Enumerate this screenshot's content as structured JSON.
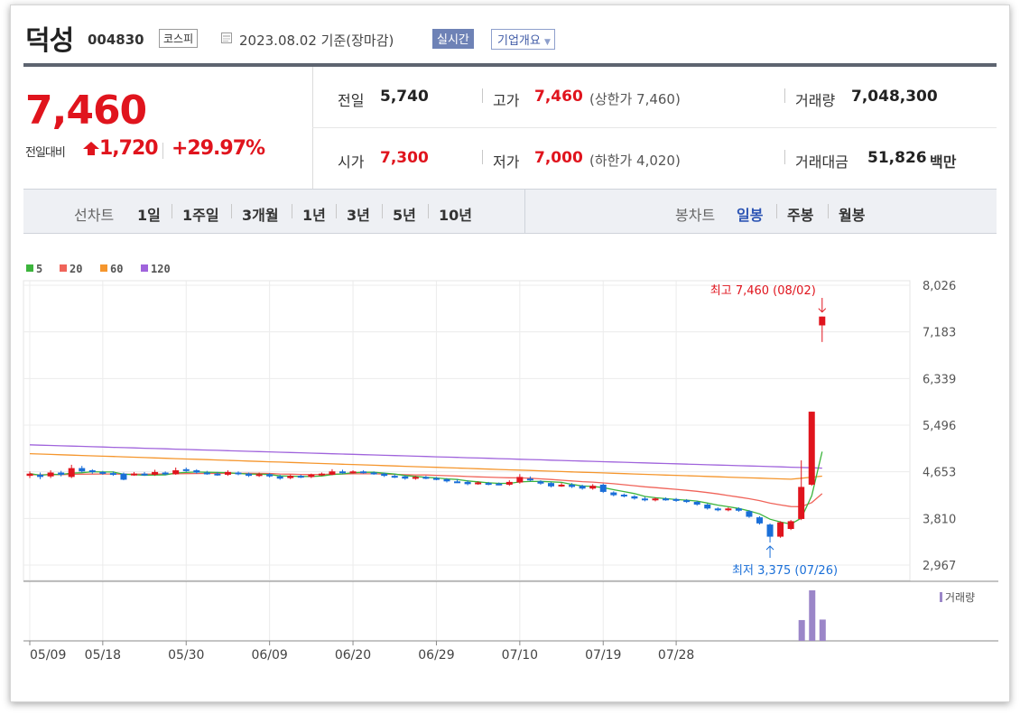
{
  "header": {
    "name": "덕성",
    "code": "004830",
    "market": "코스피",
    "date": "2023.08.02 기준(장마감)",
    "realtime": "실시간",
    "overview": "기업개요"
  },
  "quote": {
    "price": "7,460",
    "change_label": "전일대비",
    "change_amount": "1,720",
    "change_percent": "+29.97%"
  },
  "stats": {
    "prev_close_label": "전일",
    "prev_close": "5,740",
    "high_label": "고가",
    "high": "7,460",
    "upper_limit": "(상한가 7,460)",
    "volume_label": "거래량",
    "volume": "7,048,300",
    "open_label": "시가",
    "open": "7,300",
    "low_label": "저가",
    "low": "7,000",
    "lower_limit": "(하한가 4,020)",
    "amount_label": "거래대금",
    "amount": "51,826",
    "amount_unit": "백만"
  },
  "tabs": {
    "line_label": "선차트",
    "line_periods": [
      "1일",
      "1주일",
      "3개월",
      "1년",
      "3년",
      "5년",
      "10년"
    ],
    "candle_label": "봉차트",
    "candle_periods": [
      "일봉",
      "주봉",
      "월봉"
    ],
    "candle_active": "일봉"
  },
  "chart_data": {
    "type": "candlestick",
    "legend": [
      {
        "name": "5",
        "color": "#3cb43c"
      },
      {
        "name": "20",
        "color": "#f0645a"
      },
      {
        "name": "60",
        "color": "#f5962d"
      },
      {
        "name": "120",
        "color": "#a064dc"
      }
    ],
    "y_ticks": [
      "8,026",
      "7,183",
      "6,339",
      "5,496",
      "4,653",
      "3,810",
      "2,967"
    ],
    "ylim": [
      2967,
      8026
    ],
    "x_ticks": [
      "05/09",
      "05/18",
      "05/30",
      "06/09",
      "06/20",
      "06/29",
      "07/10",
      "07/19",
      "07/28"
    ],
    "high_annotation": "최고 7,460 (08/02)",
    "low_annotation": "최저 3,375 (07/26)",
    "volume_label": "거래량",
    "up_color": "#e0141d",
    "down_color": "#1a6fd8",
    "candles": [
      {
        "o": 4580,
        "c": 4620,
        "h": 4660,
        "l": 4540
      },
      {
        "o": 4600,
        "c": 4560,
        "h": 4640,
        "l": 4520
      },
      {
        "o": 4570,
        "c": 4640,
        "h": 4680,
        "l": 4540
      },
      {
        "o": 4640,
        "c": 4600,
        "h": 4670,
        "l": 4570
      },
      {
        "o": 4560,
        "c": 4720,
        "h": 4780,
        "l": 4540
      },
      {
        "o": 4720,
        "c": 4660,
        "h": 4760,
        "l": 4640
      },
      {
        "o": 4680,
        "c": 4650,
        "h": 4700,
        "l": 4620
      },
      {
        "o": 4650,
        "c": 4620,
        "h": 4670,
        "l": 4600
      },
      {
        "o": 4630,
        "c": 4600,
        "h": 4660,
        "l": 4580
      },
      {
        "o": 4620,
        "c": 4510,
        "h": 4640,
        "l": 4500
      },
      {
        "o": 4600,
        "c": 4620,
        "h": 4650,
        "l": 4580
      },
      {
        "o": 4620,
        "c": 4600,
        "h": 4650,
        "l": 4580
      },
      {
        "o": 4600,
        "c": 4650,
        "h": 4690,
        "l": 4580
      },
      {
        "o": 4640,
        "c": 4610,
        "h": 4660,
        "l": 4590
      },
      {
        "o": 4610,
        "c": 4680,
        "h": 4730,
        "l": 4600
      },
      {
        "o": 4700,
        "c": 4670,
        "h": 4730,
        "l": 4650
      },
      {
        "o": 4680,
        "c": 4640,
        "h": 4700,
        "l": 4620
      },
      {
        "o": 4640,
        "c": 4620,
        "h": 4670,
        "l": 4600
      },
      {
        "o": 4620,
        "c": 4600,
        "h": 4650,
        "l": 4580
      },
      {
        "o": 4600,
        "c": 4650,
        "h": 4680,
        "l": 4580
      },
      {
        "o": 4640,
        "c": 4610,
        "h": 4660,
        "l": 4590
      },
      {
        "o": 4620,
        "c": 4580,
        "h": 4640,
        "l": 4560
      },
      {
        "o": 4580,
        "c": 4610,
        "h": 4640,
        "l": 4560
      },
      {
        "o": 4610,
        "c": 4570,
        "h": 4630,
        "l": 4550
      },
      {
        "o": 4570,
        "c": 4530,
        "h": 4600,
        "l": 4510
      },
      {
        "o": 4540,
        "c": 4580,
        "h": 4600,
        "l": 4520
      },
      {
        "o": 4580,
        "c": 4560,
        "h": 4600,
        "l": 4540
      },
      {
        "o": 4560,
        "c": 4600,
        "h": 4620,
        "l": 4540
      },
      {
        "o": 4600,
        "c": 4620,
        "h": 4640,
        "l": 4580
      },
      {
        "o": 4600,
        "c": 4660,
        "h": 4700,
        "l": 4590
      },
      {
        "o": 4660,
        "c": 4640,
        "h": 4690,
        "l": 4620
      },
      {
        "o": 4640,
        "c": 4660,
        "h": 4680,
        "l": 4620
      },
      {
        "o": 4660,
        "c": 4640,
        "h": 4680,
        "l": 4620
      },
      {
        "o": 4640,
        "c": 4620,
        "h": 4660,
        "l": 4600
      },
      {
        "o": 4620,
        "c": 4580,
        "h": 4640,
        "l": 4560
      },
      {
        "o": 4580,
        "c": 4560,
        "h": 4610,
        "l": 4540
      },
      {
        "o": 4570,
        "c": 4530,
        "h": 4590,
        "l": 4510
      },
      {
        "o": 4530,
        "c": 4560,
        "h": 4580,
        "l": 4510
      },
      {
        "o": 4560,
        "c": 4540,
        "h": 4580,
        "l": 4520
      },
      {
        "o": 4540,
        "c": 4520,
        "h": 4560,
        "l": 4500
      },
      {
        "o": 4520,
        "c": 4480,
        "h": 4540,
        "l": 4460
      },
      {
        "o": 4480,
        "c": 4470,
        "h": 4520,
        "l": 4450
      },
      {
        "o": 4470,
        "c": 4430,
        "h": 4500,
        "l": 4410
      },
      {
        "o": 4440,
        "c": 4460,
        "h": 4480,
        "l": 4420
      },
      {
        "o": 4450,
        "c": 4430,
        "h": 4470,
        "l": 4410
      },
      {
        "o": 4440,
        "c": 4430,
        "h": 4460,
        "l": 4410
      },
      {
        "o": 4420,
        "c": 4470,
        "h": 4500,
        "l": 4400
      },
      {
        "o": 4460,
        "c": 4560,
        "h": 4610,
        "l": 4440
      },
      {
        "o": 4530,
        "c": 4500,
        "h": 4570,
        "l": 4480
      },
      {
        "o": 4480,
        "c": 4440,
        "h": 4500,
        "l": 4420
      },
      {
        "o": 4450,
        "c": 4390,
        "h": 4470,
        "l": 4370
      },
      {
        "o": 4400,
        "c": 4420,
        "h": 4450,
        "l": 4380
      },
      {
        "o": 4420,
        "c": 4380,
        "h": 4450,
        "l": 4360
      },
      {
        "o": 4400,
        "c": 4350,
        "h": 4420,
        "l": 4330
      },
      {
        "o": 4350,
        "c": 4400,
        "h": 4430,
        "l": 4330
      },
      {
        "o": 4420,
        "c": 4290,
        "h": 4440,
        "l": 4270
      },
      {
        "o": 4280,
        "c": 4230,
        "h": 4300,
        "l": 4210
      },
      {
        "o": 4240,
        "c": 4210,
        "h": 4260,
        "l": 4190
      },
      {
        "o": 4210,
        "c": 4170,
        "h": 4230,
        "l": 4150
      },
      {
        "o": 4170,
        "c": 4140,
        "h": 4200,
        "l": 4120
      },
      {
        "o": 4140,
        "c": 4170,
        "h": 4190,
        "l": 4120
      },
      {
        "o": 4170,
        "c": 4150,
        "h": 4190,
        "l": 4130
      },
      {
        "o": 4160,
        "c": 4130,
        "h": 4180,
        "l": 4110
      },
      {
        "o": 4140,
        "c": 4110,
        "h": 4160,
        "l": 4090
      },
      {
        "o": 4110,
        "c": 4060,
        "h": 4130,
        "l": 4040
      },
      {
        "o": 4060,
        "c": 3990,
        "h": 4080,
        "l": 3970
      },
      {
        "o": 3990,
        "c": 3960,
        "h": 4010,
        "l": 3940
      },
      {
        "o": 3960,
        "c": 3990,
        "h": 4010,
        "l": 3940
      },
      {
        "o": 3990,
        "c": 3950,
        "h": 4010,
        "l": 3930
      },
      {
        "o": 3940,
        "c": 3840,
        "h": 3960,
        "l": 3820
      },
      {
        "o": 3830,
        "c": 3720,
        "h": 3850,
        "l": 3700
      },
      {
        "o": 3700,
        "c": 3480,
        "h": 3720,
        "l": 3375
      },
      {
        "o": 3480,
        "c": 3740,
        "h": 3760,
        "l": 3460
      },
      {
        "o": 3620,
        "c": 3760,
        "h": 3780,
        "l": 3600
      },
      {
        "o": 3800,
        "c": 4380,
        "h": 4860,
        "l": 3780
      },
      {
        "o": 4420,
        "c": 5740,
        "h": 5740,
        "l": 4400
      },
      {
        "o": 7300,
        "c": 7460,
        "h": 7460,
        "l": 7000
      }
    ],
    "volume": [
      0,
      0,
      0,
      0,
      0,
      0,
      0,
      0,
      0,
      0,
      0,
      0,
      0,
      0,
      0,
      0,
      0,
      0,
      0,
      0,
      0,
      0,
      0,
      0,
      0,
      0,
      0,
      0,
      0,
      0,
      0,
      0,
      0,
      0,
      0,
      0,
      0,
      0,
      0,
      0,
      0,
      0,
      0,
      0,
      0,
      0,
      0,
      0,
      0,
      0,
      0,
      0,
      0,
      0,
      0,
      0,
      0,
      0,
      0,
      0,
      0,
      0,
      0,
      0,
      0,
      0,
      0,
      0,
      0,
      0,
      0,
      0,
      0,
      0,
      4200000,
      10200000,
      4300000
    ]
  }
}
